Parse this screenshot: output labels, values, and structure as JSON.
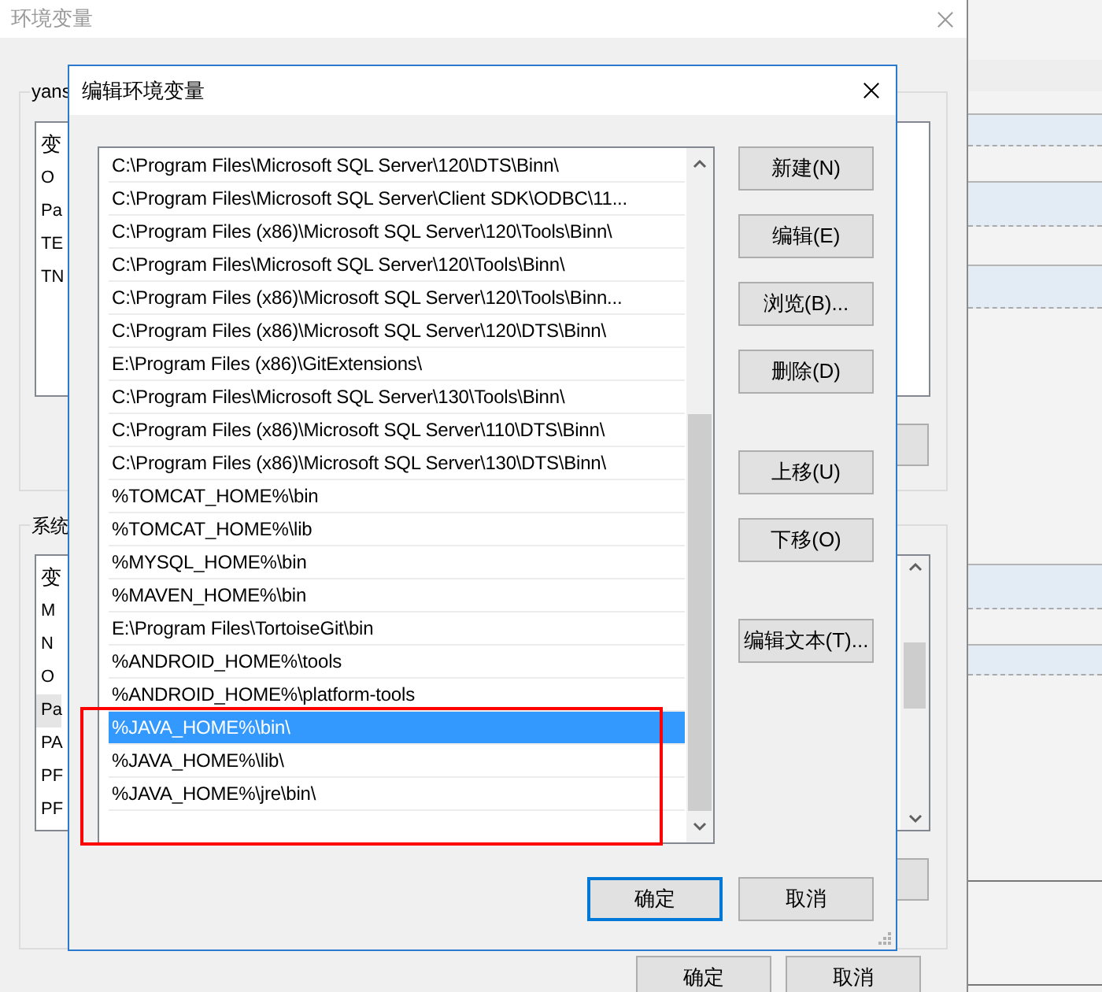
{
  "back_window": {
    "title": "环境变量",
    "user_group": {
      "label": "yans",
      "header": "变",
      "rows": [
        {
          "text": "O",
          "selected": false
        },
        {
          "text": "Pa",
          "selected": false
        },
        {
          "text": "TE",
          "selected": false
        },
        {
          "text": "TN",
          "selected": false
        }
      ]
    },
    "system_group": {
      "label": "系统",
      "header": "变",
      "rows": [
        {
          "text": "M",
          "selected": false
        },
        {
          "text": "N",
          "selected": false
        },
        {
          "text": "O",
          "selected": false
        },
        {
          "text": "Pa",
          "selected": true
        },
        {
          "text": "PA",
          "selected": false
        },
        {
          "text": "PF",
          "selected": false
        },
        {
          "text": "PF",
          "selected": false
        }
      ]
    },
    "buttons": [
      "确定",
      "取消"
    ]
  },
  "dialog": {
    "title": "编辑环境变量",
    "paths": [
      {
        "text": "C:\\Program Files\\Microsoft SQL Server\\120\\DTS\\Binn\\",
        "selected": false
      },
      {
        "text": "C:\\Program Files\\Microsoft SQL Server\\Client SDK\\ODBC\\11...",
        "selected": false
      },
      {
        "text": "C:\\Program Files (x86)\\Microsoft SQL Server\\120\\Tools\\Binn\\",
        "selected": false
      },
      {
        "text": "C:\\Program Files\\Microsoft SQL Server\\120\\Tools\\Binn\\",
        "selected": false
      },
      {
        "text": "C:\\Program Files (x86)\\Microsoft SQL Server\\120\\Tools\\Binn...",
        "selected": false
      },
      {
        "text": "C:\\Program Files (x86)\\Microsoft SQL Server\\120\\DTS\\Binn\\",
        "selected": false
      },
      {
        "text": "E:\\Program Files (x86)\\GitExtensions\\",
        "selected": false
      },
      {
        "text": "C:\\Program Files\\Microsoft SQL Server\\130\\Tools\\Binn\\",
        "selected": false
      },
      {
        "text": "C:\\Program Files (x86)\\Microsoft SQL Server\\110\\DTS\\Binn\\",
        "selected": false
      },
      {
        "text": "C:\\Program Files (x86)\\Microsoft SQL Server\\130\\DTS\\Binn\\",
        "selected": false
      },
      {
        "text": "%TOMCAT_HOME%\\bin",
        "selected": false
      },
      {
        "text": "%TOMCAT_HOME%\\lib",
        "selected": false
      },
      {
        "text": "%MYSQL_HOME%\\bin",
        "selected": false
      },
      {
        "text": "%MAVEN_HOME%\\bin",
        "selected": false
      },
      {
        "text": "E:\\Program Files\\TortoiseGit\\bin",
        "selected": false
      },
      {
        "text": "%ANDROID_HOME%\\tools",
        "selected": false
      },
      {
        "text": "%ANDROID_HOME%\\platform-tools",
        "selected": false
      },
      {
        "text": "%JAVA_HOME%\\bin\\",
        "selected": true
      },
      {
        "text": "%JAVA_HOME%\\lib\\",
        "selected": false
      },
      {
        "text": "%JAVA_HOME%\\jre\\bin\\",
        "selected": false
      }
    ],
    "side_button_groups": [
      [
        "新建(N)",
        "编辑(E)",
        "浏览(B)...",
        "删除(D)"
      ],
      [
        "上移(U)",
        "下移(O)"
      ],
      [
        "编辑文本(T)..."
      ]
    ],
    "ok": "确定",
    "cancel": "取消"
  }
}
